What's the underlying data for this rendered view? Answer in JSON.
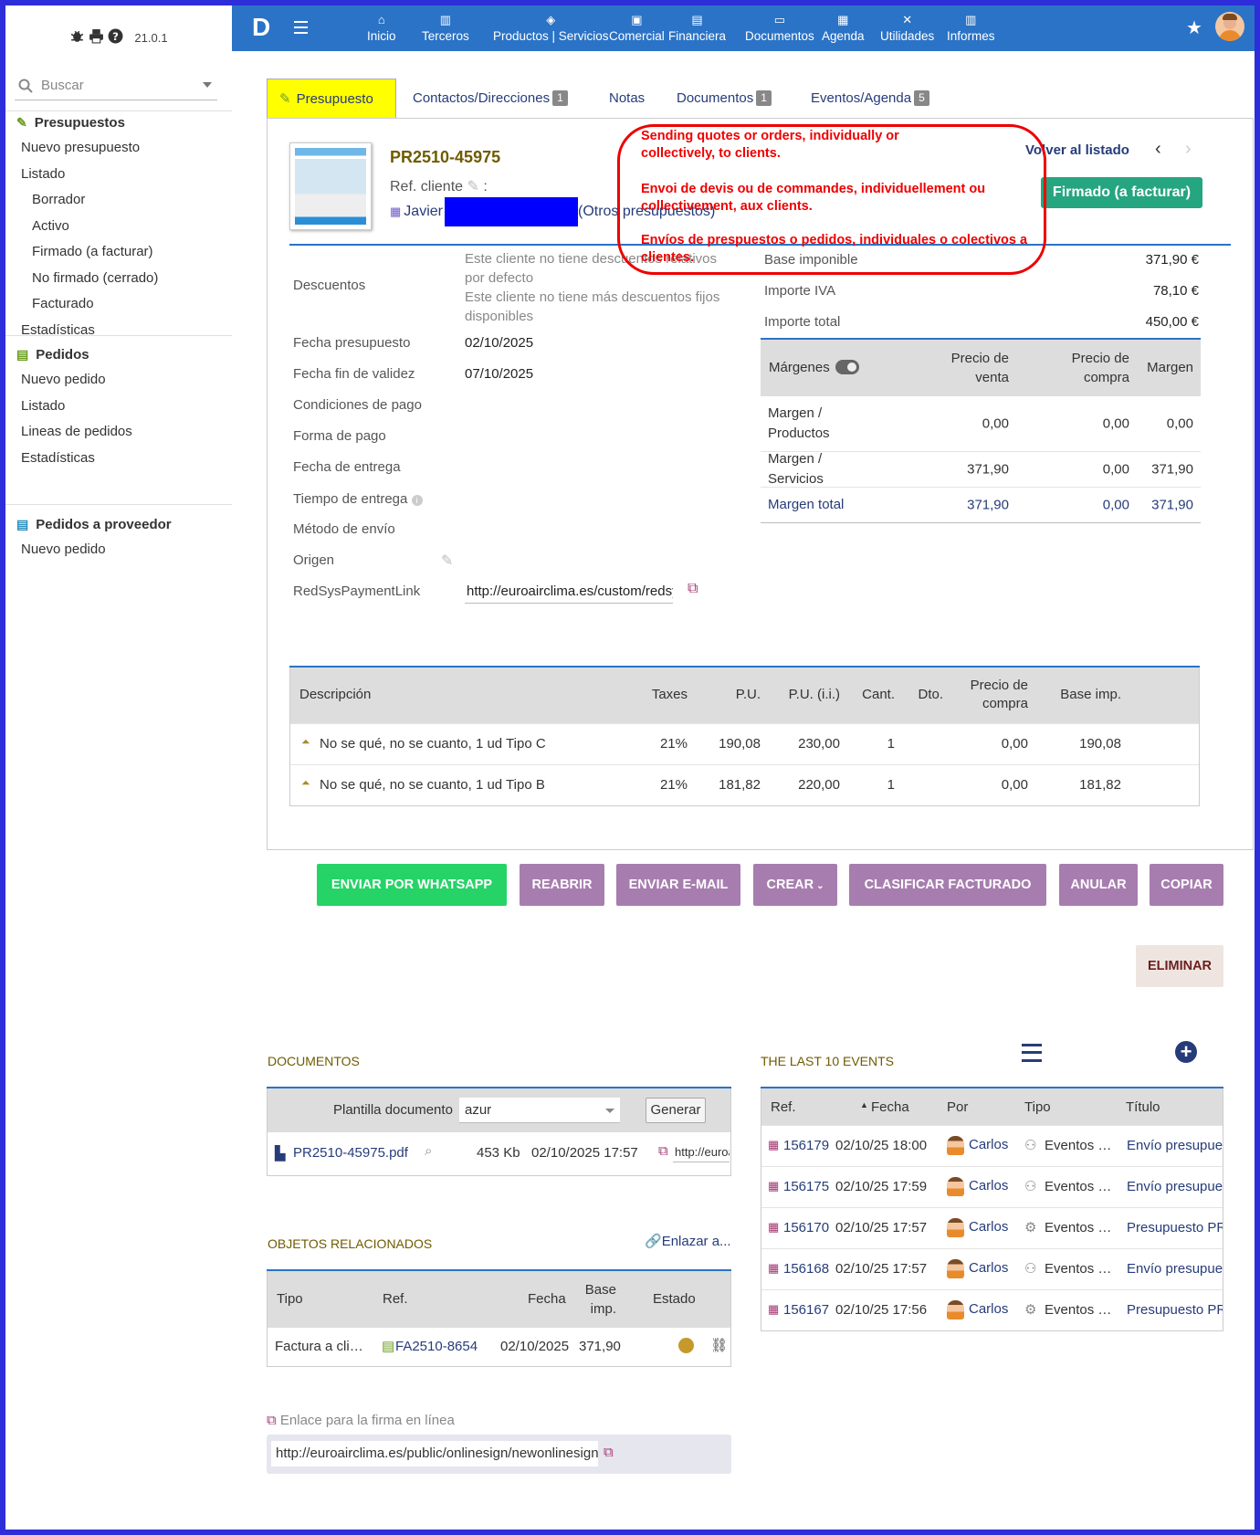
{
  "sidebar": {
    "version": "21.0.1",
    "search_placeholder": "Buscar",
    "sections": [
      {
        "title": "Presupuestos",
        "items": [
          {
            "label": "Nuevo presupuesto",
            "sub": false
          },
          {
            "label": "Listado",
            "sub": false
          },
          {
            "label": "Borrador",
            "sub": true
          },
          {
            "label": "Activo",
            "sub": true
          },
          {
            "label": "Firmado (a facturar)",
            "sub": true
          },
          {
            "label": "No firmado (cerrado)",
            "sub": true
          },
          {
            "label": "Facturado",
            "sub": true
          },
          {
            "label": "Estadísticas",
            "sub": false
          }
        ]
      },
      {
        "title": "Pedidos",
        "items": [
          {
            "label": "Nuevo pedido",
            "sub": false
          },
          {
            "label": "Listado",
            "sub": false
          },
          {
            "label": "Lineas de pedidos",
            "sub": false
          },
          {
            "label": "Estadísticas",
            "sub": false
          }
        ]
      },
      {
        "title": "Pedidos a proveedor",
        "items": [
          {
            "label": "Nuevo pedido",
            "sub": false
          }
        ]
      }
    ]
  },
  "topnav": {
    "logo": "D",
    "items": [
      {
        "label": "Inicio",
        "icon": "home-icon"
      },
      {
        "label": "Terceros",
        "icon": "building-icon"
      },
      {
        "label": "Productos | Servicios",
        "icon": "cube-icon"
      },
      {
        "label": "Comercial",
        "icon": "briefcase-icon"
      },
      {
        "label": "Financiera",
        "icon": "file-dollar-icon"
      },
      {
        "label": "Documentos",
        "icon": "folder-icon"
      },
      {
        "label": "Agenda",
        "icon": "calendar-icon"
      },
      {
        "label": "Utilidades",
        "icon": "tools-icon"
      },
      {
        "label": "Informes",
        "icon": "report-icon"
      }
    ]
  },
  "tabs": [
    {
      "label": "Presupuesto",
      "badge": ""
    },
    {
      "label": "Contactos/Direcciones",
      "badge": "1"
    },
    {
      "label": "Notas",
      "badge": ""
    },
    {
      "label": "Documentos",
      "badge": "1"
    },
    {
      "label": "Eventos/Agenda",
      "badge": "5"
    }
  ],
  "header": {
    "ref": "PR2510-45975",
    "ref_cliente": "Ref. cliente",
    "ref_cliente_sep": ":",
    "client": "Javier",
    "other": "(Otros presupuestos)",
    "back": "Volver al listado",
    "status": "Firmado (a facturar)"
  },
  "annotation": {
    "en": "Sending quotes or orders, individually or collectively, to clients.",
    "fr": "Envoi de devis ou de commandes, individuellement ou collectivement, aux clients.",
    "es": "Envíos de prespuestos o pedidos, individuales o colectivos a clientes."
  },
  "fields": {
    "descuentos_label": "Descuentos",
    "descuentos_1": "Este cliente no tiene descuentos relativos por defecto",
    "descuentos_2": "Este cliente no tiene más descuentos fijos disponibles",
    "fecha_label": "Fecha presupuesto",
    "fecha": "02/10/2025",
    "fin_label": "Fecha fin de validez",
    "fin": "07/10/2025",
    "cond_label": "Condiciones de pago",
    "forma_label": "Forma de pago",
    "entrega_label": "Fecha de entrega",
    "tiempo_label": "Tiempo de entrega",
    "metodo_label": "Método de envío",
    "origen_label": "Origen",
    "redsys_label": "RedSysPaymentLink",
    "redsys": "http://euroairclima.es/custom/redsys"
  },
  "totals": [
    {
      "label": "Base imponible",
      "value": "371,90 €"
    },
    {
      "label": "Importe IVA",
      "value": "78,10 €"
    },
    {
      "label": "Importe total",
      "value": "450,00 €"
    }
  ],
  "margins": {
    "headers": [
      "Márgenes",
      "Precio de venta",
      "Precio de compra",
      "Margen"
    ],
    "rows": [
      {
        "label": "Margen / Productos",
        "venta": "0,00",
        "compra": "0,00",
        "margen": "0,00"
      },
      {
        "label": "Margen / Servicios",
        "venta": "371,90",
        "compra": "0,00",
        "margen": "371,90"
      },
      {
        "label": "Margen total",
        "venta": "371,90",
        "compra": "0,00",
        "margen": "371,90"
      }
    ]
  },
  "lines": {
    "headers": [
      "Descripción",
      "Taxes",
      "P.U.",
      "P.U. (i.i.)",
      "Cant.",
      "Dto.",
      "Precio de compra",
      "Base imp."
    ],
    "rows": [
      {
        "desc": "No se qué, no se cuanto, 1 ud Tipo C",
        "tax": "21%",
        "pu": "190,08",
        "pui": "230,00",
        "qty": "1",
        "dto": "",
        "compra": "0,00",
        "base": "190,08"
      },
      {
        "desc": "No se qué, no se cuanto, 1 ud Tipo B",
        "tax": "21%",
        "pu": "181,82",
        "pui": "220,00",
        "qty": "1",
        "dto": "",
        "compra": "0,00",
        "base": "181,82"
      }
    ]
  },
  "buttons": {
    "whatsapp": "ENVIAR POR WHATSAPP",
    "reabrir": "REABRIR",
    "email": "ENVIAR E-MAIL",
    "crear": "CREAR",
    "clasificar": "CLASIFICAR FACTURADO",
    "anular": "ANULAR",
    "copiar": "COPIAR",
    "eliminar": "ELIMINAR"
  },
  "colors": {
    "nav": "#2b73c6",
    "whatsapp": "#25d366",
    "action": "#a77daf",
    "status": "#25a580",
    "highlight": "#ffff00"
  },
  "documentos": {
    "title": "DOCUMENTOS",
    "plantilla_label": "Plantilla documento",
    "plantilla": "azur",
    "generar": "Generar",
    "file": "PR2510-45975.pdf",
    "size": "453 Kb",
    "date": "02/10/2025 17:57",
    "link": "http://euroairclima"
  },
  "events": {
    "title": "THE LAST 10 EVENTS",
    "headers": [
      "Ref.",
      "Fecha",
      "Por",
      "Tipo",
      "Título"
    ],
    "rows": [
      {
        "ref": "156179",
        "date": "02/10/25 18:00",
        "por": "Carlos",
        "tipo": "Eventos …",
        "titulo": "Envío presupuesto"
      },
      {
        "ref": "156175",
        "date": "02/10/25 17:59",
        "por": "Carlos",
        "tipo": "Eventos …",
        "titulo": "Envío presupuesto"
      },
      {
        "ref": "156170",
        "date": "02/10/25 17:57",
        "por": "Carlos",
        "tipo": "Eventos …",
        "titulo": "Presupuesto PR"
      },
      {
        "ref": "156168",
        "date": "02/10/25 17:57",
        "por": "Carlos",
        "tipo": "Eventos …",
        "titulo": "Envío presupuesto"
      },
      {
        "ref": "156167",
        "date": "02/10/25 17:56",
        "por": "Carlos",
        "tipo": "Eventos …",
        "titulo": "Presupuesto PR"
      }
    ]
  },
  "related": {
    "title": "OBJETOS RELACIONADOS",
    "link": "Enlazar a...",
    "headers": [
      "Tipo",
      "Ref.",
      "Fecha",
      "Base imp.",
      "Estado"
    ],
    "rows": [
      {
        "tipo": "Factura a cli…",
        "ref": "FA2510-8654",
        "fecha": "02/10/2025",
        "base": "371,90"
      }
    ]
  },
  "firma": {
    "label": "Enlace para la firma en línea",
    "url": "http://euroairclima.es/public/onlinesign/newonlinesign"
  }
}
